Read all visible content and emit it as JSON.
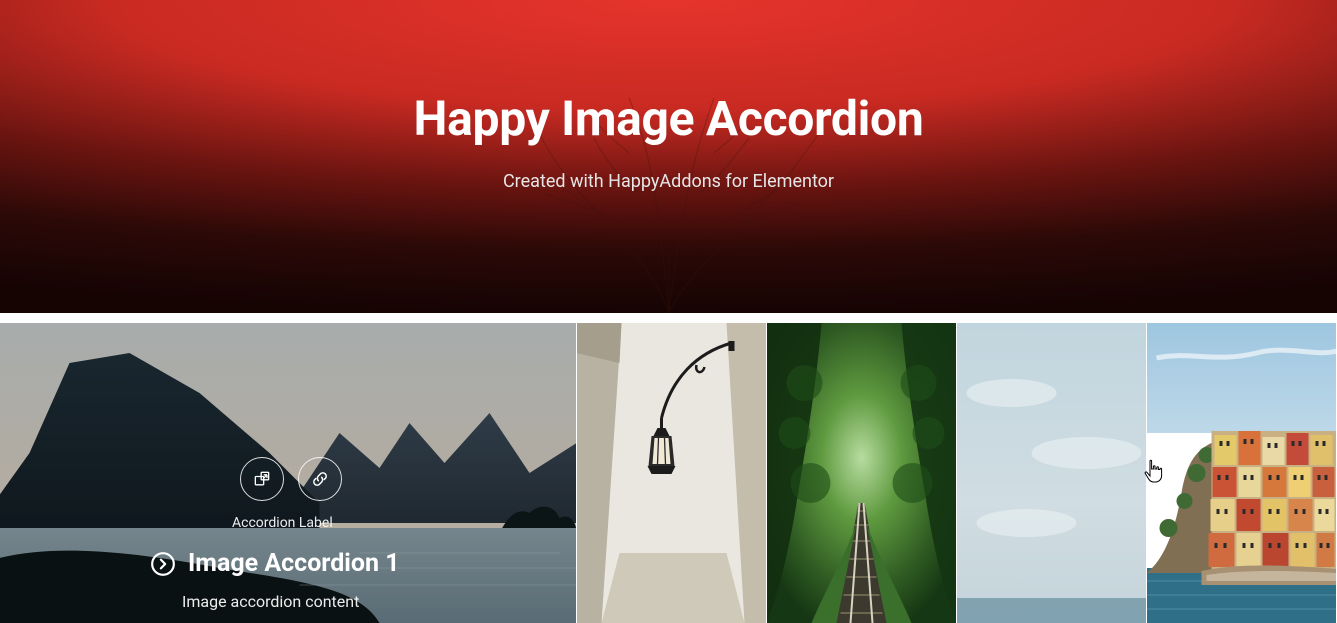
{
  "hero": {
    "title": "Happy Image Accordion",
    "subtitle": "Created with HappyAddons for Elementor"
  },
  "accordion": {
    "icons": {
      "expand": "expand-icon",
      "link": "link-icon"
    },
    "label": "Accordion Label",
    "title": "Image Accordion 1",
    "description": "Image accordion content"
  }
}
